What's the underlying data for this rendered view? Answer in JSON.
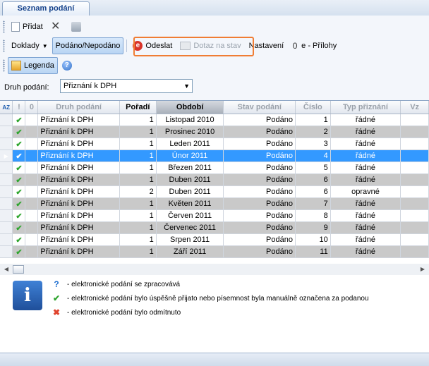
{
  "tab": {
    "title": "Seznam podání"
  },
  "toolbar1": {
    "add_label": "Přidat"
  },
  "toolbar2": {
    "doklady_label": "Doklady",
    "podano_label": "Podáno/Nepodáno",
    "odeslat_label": "Odeslat",
    "dotaz_label": "Dotaz na stav",
    "nastaveni_label": "Nastavení",
    "prilohy_label": "e - Přílohy"
  },
  "toolbar3": {
    "legend_label": "Legenda"
  },
  "filter": {
    "label": "Druh podání:",
    "selected": "Přiznání k DPH"
  },
  "grid": {
    "sort_icon_label": "AZ",
    "columns": [
      "!",
      "0",
      "Druh podání",
      "Pořadí",
      "Období",
      "Stav podání",
      "Číslo",
      "Typ přiznání",
      "Vz"
    ],
    "rows": [
      {
        "druh": "Přiznání k DPH",
        "poradi": "1",
        "obdobi": "Listopad 2010",
        "stav": "Podáno",
        "cislo": "1",
        "typ": "řádné"
      },
      {
        "druh": "Přiznání k DPH",
        "poradi": "1",
        "obdobi": "Prosinec 2010",
        "stav": "Podáno",
        "cislo": "2",
        "typ": "řádné"
      },
      {
        "druh": "Přiznání k DPH",
        "poradi": "1",
        "obdobi": "Leden 2011",
        "stav": "Podáno",
        "cislo": "3",
        "typ": "řádné"
      },
      {
        "druh": "Přiznání k DPH",
        "poradi": "1",
        "obdobi": "Únor 2011",
        "stav": "Podáno",
        "cislo": "4",
        "typ": "řádné"
      },
      {
        "druh": "Přiznání k DPH",
        "poradi": "1",
        "obdobi": "Březen 2011",
        "stav": "Podáno",
        "cislo": "5",
        "typ": "řádné"
      },
      {
        "druh": "Přiznání k DPH",
        "poradi": "1",
        "obdobi": "Duben 2011",
        "stav": "Podáno",
        "cislo": "6",
        "typ": "řádné"
      },
      {
        "druh": "Přiznání k DPH",
        "poradi": "2",
        "obdobi": "Duben 2011",
        "stav": "Podáno",
        "cislo": "6",
        "typ": "opravné"
      },
      {
        "druh": "Přiznání k DPH",
        "poradi": "1",
        "obdobi": "Květen 2011",
        "stav": "Podáno",
        "cislo": "7",
        "typ": "řádné"
      },
      {
        "druh": "Přiznání k DPH",
        "poradi": "1",
        "obdobi": "Červen 2011",
        "stav": "Podáno",
        "cislo": "8",
        "typ": "řádné"
      },
      {
        "druh": "Přiznání k DPH",
        "poradi": "1",
        "obdobi": "Červenec 2011",
        "stav": "Podáno",
        "cislo": "9",
        "typ": "řádné"
      },
      {
        "druh": "Přiznání k DPH",
        "poradi": "1",
        "obdobi": "Srpen 2011",
        "stav": "Podáno",
        "cislo": "10",
        "typ": "řádné"
      },
      {
        "druh": "Přiznání k DPH",
        "poradi": "1",
        "obdobi": "Září 2011",
        "stav": "Podáno",
        "cislo": "11",
        "typ": "řádné"
      }
    ]
  },
  "legend": {
    "items": [
      {
        "icon": "question-icon",
        "symbol": "?",
        "color": "#1f6fd0",
        "text": "- elektronické podání se zpracovává"
      },
      {
        "icon": "check-icon",
        "symbol": "✔",
        "color": "#2fa52f",
        "text": "- elektronické podání bylo úspěšně přijato nebo písemnost byla manuálně označena za podanou"
      },
      {
        "icon": "cross-icon",
        "symbol": "✖",
        "color": "#e0452f",
        "text": "- elektronické podání bylo odmítnuto"
      }
    ]
  },
  "colors": {
    "accent_highlight": "#f07d34",
    "selection": "#3399ff",
    "alt_row": "#c9c9c9"
  }
}
